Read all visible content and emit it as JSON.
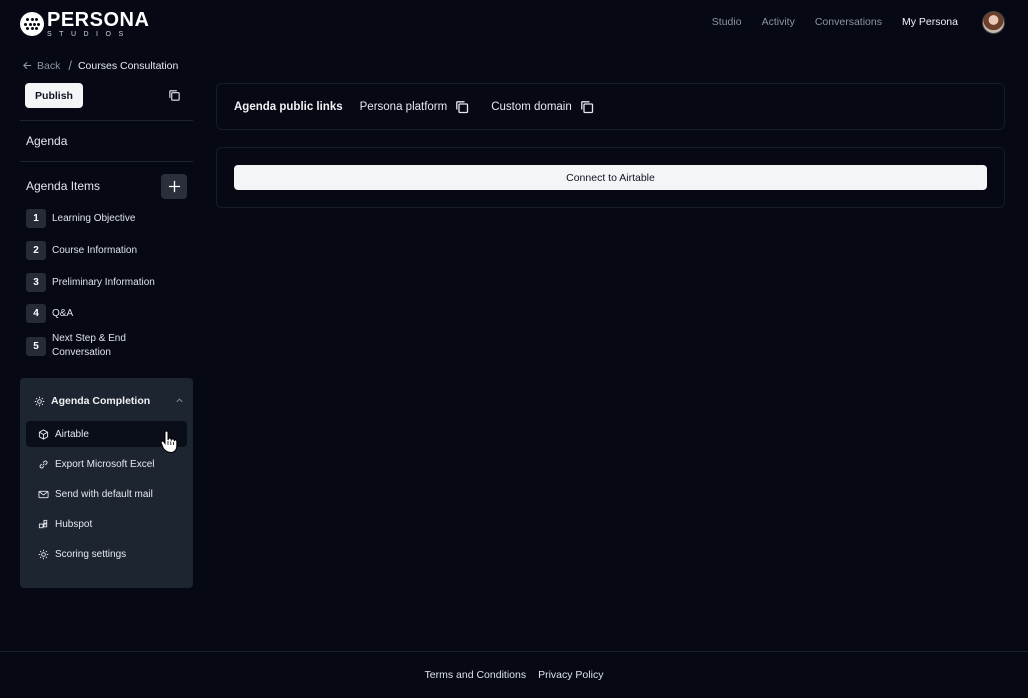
{
  "app": {
    "logo_main": "PERSONA",
    "logo_sub": "STUDIOS"
  },
  "nav": {
    "items": [
      {
        "label": "Studio"
      },
      {
        "label": "Activity"
      },
      {
        "label": "Conversations"
      },
      {
        "label": "My Persona"
      }
    ],
    "active": "My Persona"
  },
  "breadcrumb": {
    "back_label": "Back",
    "current": "Courses Consultation"
  },
  "sidebar": {
    "publish_label": "Publish",
    "agenda_title": "Agenda",
    "items_title": "Agenda Items",
    "items": [
      {
        "num": "1",
        "label": "Learning Objective"
      },
      {
        "num": "2",
        "label": "Course Information"
      },
      {
        "num": "3",
        "label": "Preliminary Information"
      },
      {
        "num": "4",
        "label": "Q&A"
      },
      {
        "num": "5",
        "label": "Next Step & End Conversation"
      }
    ],
    "completion": {
      "title": "Agenda Completion",
      "expanded": true,
      "items": [
        {
          "label": "Airtable",
          "icon": "cube-icon",
          "selected": true
        },
        {
          "label": "Export Microsoft Excel",
          "icon": "link-icon",
          "selected": false
        },
        {
          "label": "Send with default mail",
          "icon": "mail-icon",
          "selected": false
        },
        {
          "label": "Hubspot",
          "icon": "hubspot-icon",
          "selected": false
        },
        {
          "label": "Scoring settings",
          "icon": "gear-icon",
          "selected": false
        }
      ]
    }
  },
  "main": {
    "links_title": "Agenda public links",
    "persona_platform_label": "Persona platform",
    "custom_domain_label": "Custom domain",
    "airtable_button_label": "Connect to Airtable"
  },
  "footer": {
    "terms_label": "Terms and Conditions",
    "privacy_label": "Privacy Policy"
  },
  "colors": {
    "background": "#060914",
    "panel": "#1d2530",
    "button_light": "#f4f5f7",
    "text_muted": "#8d93a3"
  }
}
